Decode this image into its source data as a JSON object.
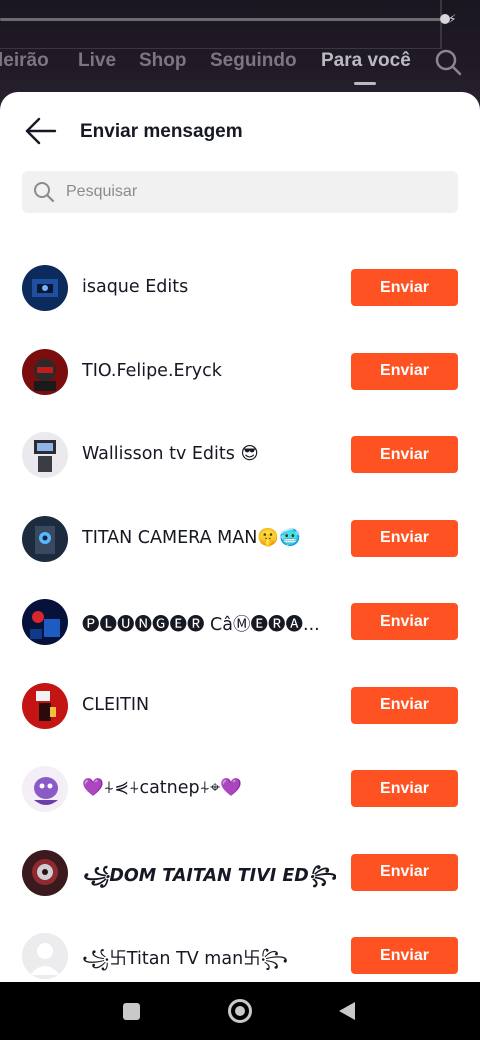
{
  "app_nav": {
    "tabs": [
      {
        "label": "leirão"
      },
      {
        "label": "Live"
      },
      {
        "label": "Shop"
      },
      {
        "label": "Seguindo"
      },
      {
        "label": "Para você"
      }
    ]
  },
  "sheet": {
    "title": "Enviar mensagem",
    "search": {
      "placeholder": "Pesquisar",
      "value": ""
    },
    "contacts": [
      {
        "name": "isaque Edits",
        "button": "Enviar"
      },
      {
        "name": "TIO.Felipe.Eryck",
        "button": "Enviar"
      },
      {
        "name": "Wallisson tv Edits 😎",
        "button": "Enviar"
      },
      {
        "name": "TITAN CAMERA MAN🤫🥶",
        "button": "Enviar"
      },
      {
        "name": "🅟🅛🅤🅝🅖🅔🅡 CâⓂ🅔🅡🅐...",
        "button": "Enviar"
      },
      {
        "name": "CLEITIN",
        "button": "Enviar"
      },
      {
        "name": "💜⍭⋞⍭catnep⍭⌖💜",
        "button": "Enviar"
      },
      {
        "name": "꧁DOM TAITAN TIVI ED꧂",
        "button": "Enviar"
      },
      {
        "name": "꧁卐Titan TV man卐꧂",
        "button": "Enviar"
      }
    ]
  },
  "colors": {
    "accent": "#fe5222",
    "text": "#161823",
    "placeholder": "#8a8b91"
  },
  "icons": [
    "bolt-icon",
    "search-icon",
    "back-arrow-icon",
    "recents-icon",
    "home-icon",
    "nav-back-icon"
  ]
}
